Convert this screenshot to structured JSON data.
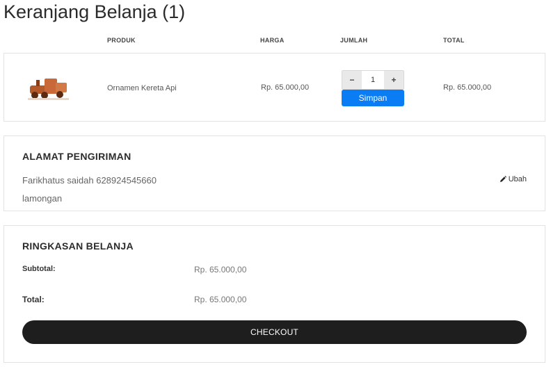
{
  "page": {
    "title": "Keranjang Belanja (1)"
  },
  "table": {
    "headers": {
      "product": "PRODUK",
      "price": "HARGA",
      "quantity": "JUMLAH",
      "total": "TOTAL"
    },
    "items": [
      {
        "name": "Ornamen Kereta Api",
        "price": "Rp. 65.000,00",
        "quantity": "1",
        "total": "Rp. 65.000,00",
        "image_icon": "wooden-train-thumbnail"
      }
    ],
    "decrement_label": "−",
    "increment_label": "+",
    "save_label": "Simpan"
  },
  "address": {
    "title": "ALAMAT PENGIRIMAN",
    "line1": "Farikhatus saidah 628924545660",
    "line2": "lamongan",
    "edit_label": "Ubah",
    "edit_icon": "pencil-icon"
  },
  "summary": {
    "title": "RINGKASAN BELANJA",
    "subtotal_label": "Subtotal:",
    "subtotal_value": "Rp. 65.000,00",
    "total_label": "Total:",
    "total_value": "Rp. 65.000,00",
    "checkout_label": "CHECKOUT"
  },
  "colors": {
    "primary_button": "#0a7cf4",
    "checkout_button": "#1e1e1e",
    "border": "#e2e2e2"
  }
}
